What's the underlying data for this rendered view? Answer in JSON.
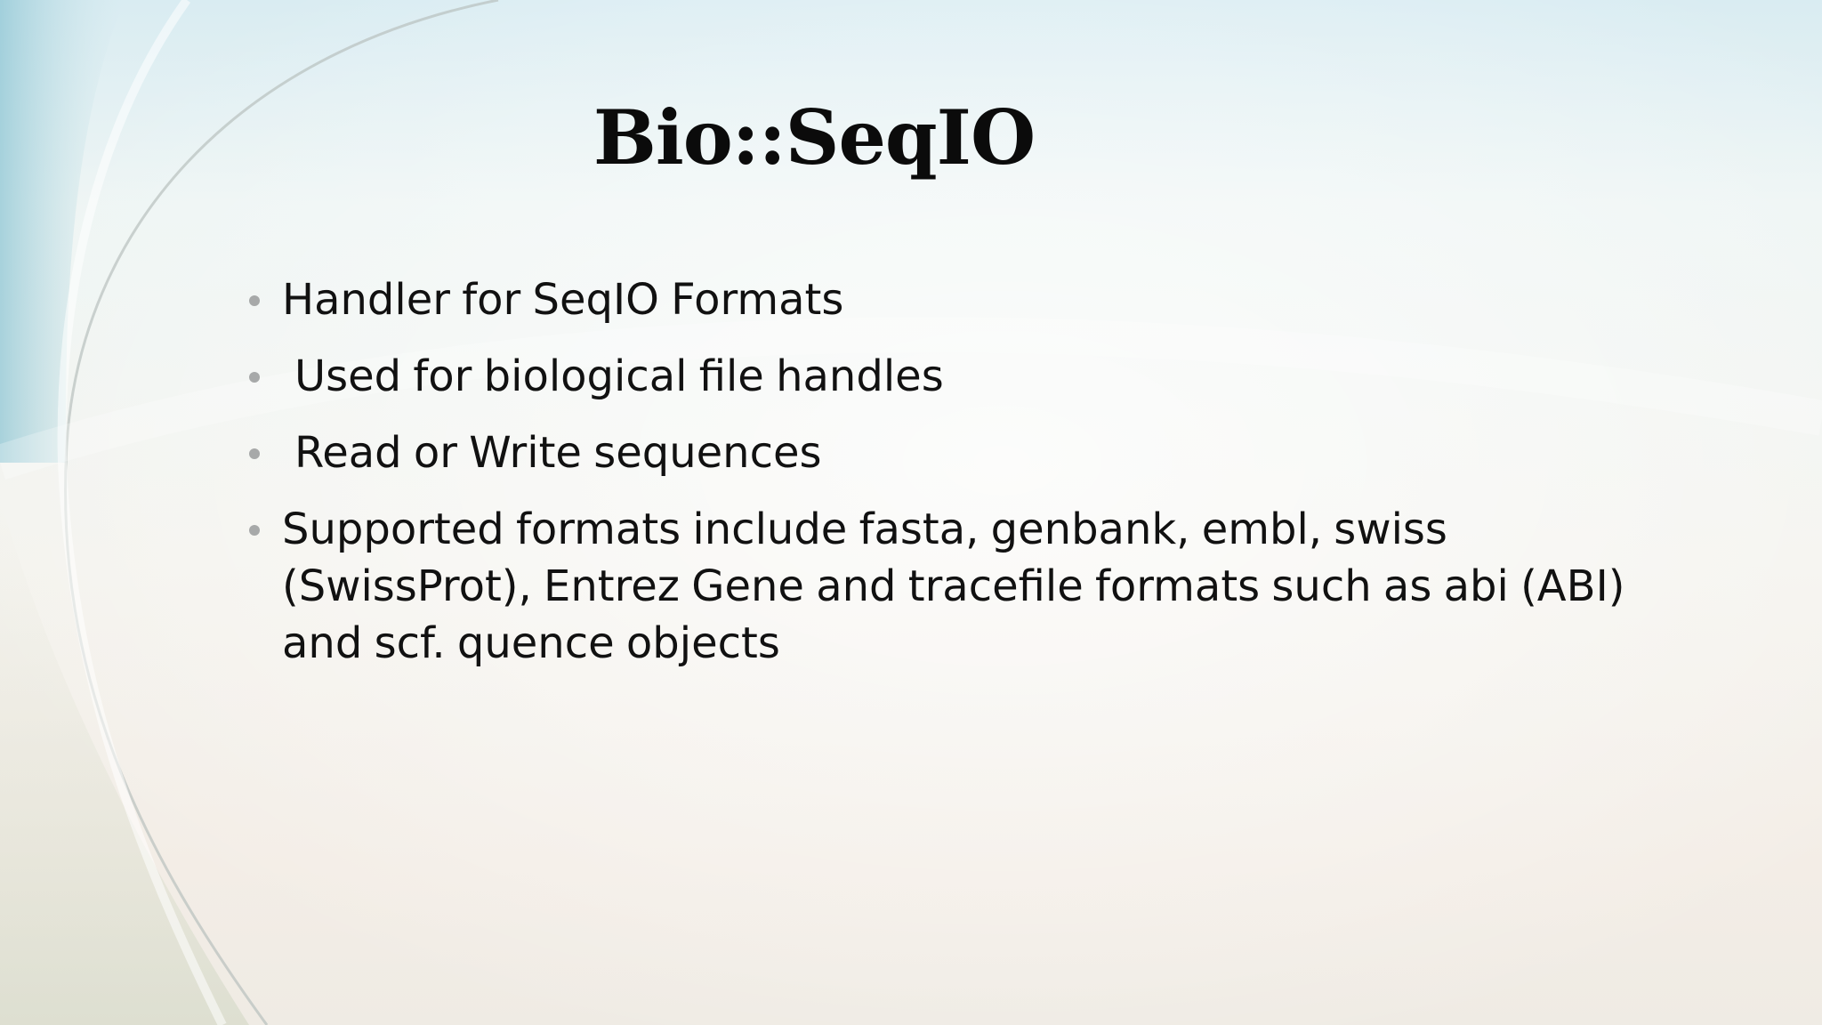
{
  "slide": {
    "title": "Bio::SeqIO",
    "bullets": [
      {
        "text": "Handler for SeqIO Formats"
      },
      {
        "text": "Used for biological file handles"
      },
      {
        "text": "Read or Write sequences"
      },
      {
        "text": "Supported formats include fasta, genbank, embl, swiss (SwissProt), Entrez Gene and tracefile formats such as abi (ABI) and scf. quence objects"
      }
    ],
    "colors": {
      "title": "#0b0b0b",
      "text": "#111111",
      "bullet": "#a7a9a9",
      "background_top": "#d9ecf2",
      "background_bottom": "#efebe4"
    }
  }
}
